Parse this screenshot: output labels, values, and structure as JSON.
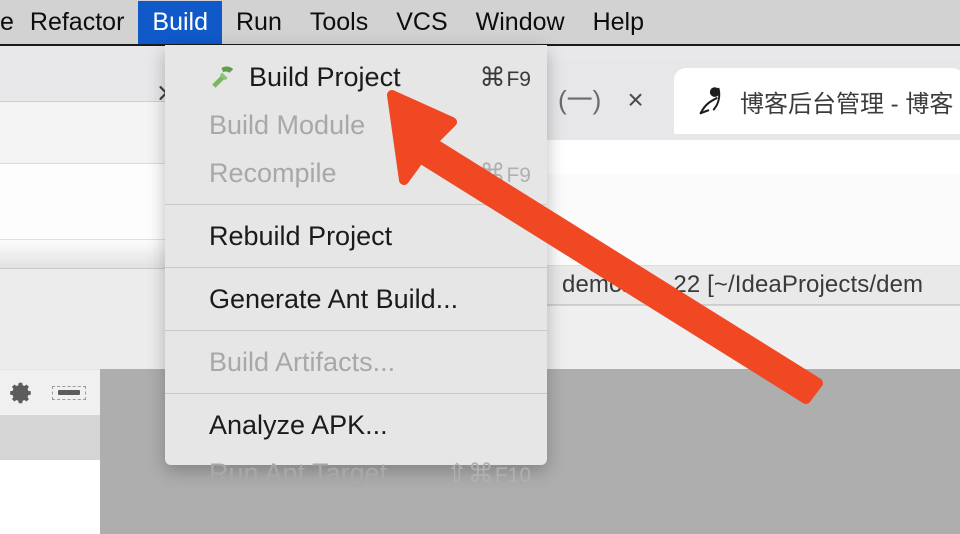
{
  "menubar": {
    "items": [
      {
        "label": "e",
        "active": false,
        "truncated": true
      },
      {
        "label": "Refactor",
        "active": false
      },
      {
        "label": "Build",
        "active": true
      },
      {
        "label": "Run",
        "active": false
      },
      {
        "label": "Tools",
        "active": false
      },
      {
        "label": "VCS",
        "active": false
      },
      {
        "label": "Window",
        "active": false
      },
      {
        "label": "Help",
        "active": false
      }
    ],
    "highlight_color": "#1059c9",
    "background_color": "#d2d2d2"
  },
  "build_menu": {
    "items": [
      {
        "label": "Build Project",
        "shortcut_symbol": "⌘",
        "shortcut_key": "F9",
        "disabled": false,
        "icon": "hammer-icon"
      },
      {
        "label": "Build Module",
        "shortcut_symbol": "",
        "shortcut_key": "",
        "disabled": true,
        "icon": ""
      },
      {
        "label": "Recompile",
        "shortcut_symbol": "⇧⌘",
        "shortcut_key": "F9",
        "disabled": true,
        "icon": ""
      },
      {
        "separator": true
      },
      {
        "label": "Rebuild Project",
        "shortcut_symbol": "",
        "shortcut_key": "",
        "disabled": false,
        "icon": ""
      },
      {
        "separator": true
      },
      {
        "label": "Generate Ant Build...",
        "shortcut_symbol": "",
        "shortcut_key": "",
        "disabled": false,
        "icon": ""
      },
      {
        "separator": true
      },
      {
        "label": "Build Artifacts...",
        "shortcut_symbol": "",
        "shortcut_key": "",
        "disabled": true,
        "icon": ""
      },
      {
        "separator": true
      },
      {
        "label": "Analyze APK...",
        "shortcut_symbol": "",
        "shortcut_key": "",
        "disabled": false,
        "icon": ""
      },
      {
        "label": "Run Ant Target",
        "shortcut_symbol": "⇧⌘",
        "shortcut_key": "F10",
        "disabled": true,
        "icon": ""
      }
    ],
    "hammer_icon_color": "#6aa84f",
    "background_color": "#e6e6e6"
  },
  "ide": {
    "project_path": "demo22…22 [~/IdeaProjects/dem",
    "chevron_icon": "chevron-right-icon",
    "gear_icon": "gear-icon",
    "hide_icon": "hide-icon"
  },
  "browser": {
    "minimize_label": "(一)",
    "close_label": "×",
    "tab": {
      "favicon": "blog-logo-icon",
      "title": "博客后台管理 - 博客"
    }
  },
  "annotation": {
    "arrow_color": "#ef4823",
    "arrow_name": "red-pointer-arrow"
  }
}
